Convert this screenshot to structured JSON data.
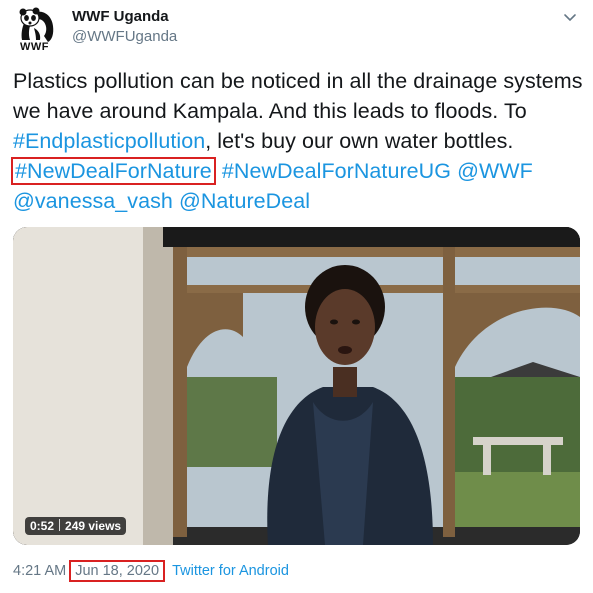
{
  "account": {
    "display_name": "WWF Uganda",
    "handle": "@WWFUganda",
    "avatar_icon": "wwf-panda-logo",
    "avatar_logo_text": "WWF"
  },
  "tweet": {
    "text_part1": "Plastics pollution can be noticed in all the drainage systems we have around Kampala. And this leads to floods. To ",
    "hashtag1": "#Endplasticpollution",
    "text_part2": ", let's buy our own water bottles. ",
    "hashtag2": "#NewDealForNature",
    "hashtag3": "#NewDealForNatureUG",
    "mention1": "@WWF",
    "mention2": "@vanessa_vash",
    "mention3": "@NatureDeal"
  },
  "video": {
    "duration": "0:52",
    "views": "249 views"
  },
  "footer": {
    "time": "4:21 AM",
    "date": "Jun 18, 2020",
    "source": "Twitter for Android"
  },
  "colors": {
    "link": "#1b95e0",
    "highlight_box": "#d92121",
    "muted": "#657786"
  }
}
